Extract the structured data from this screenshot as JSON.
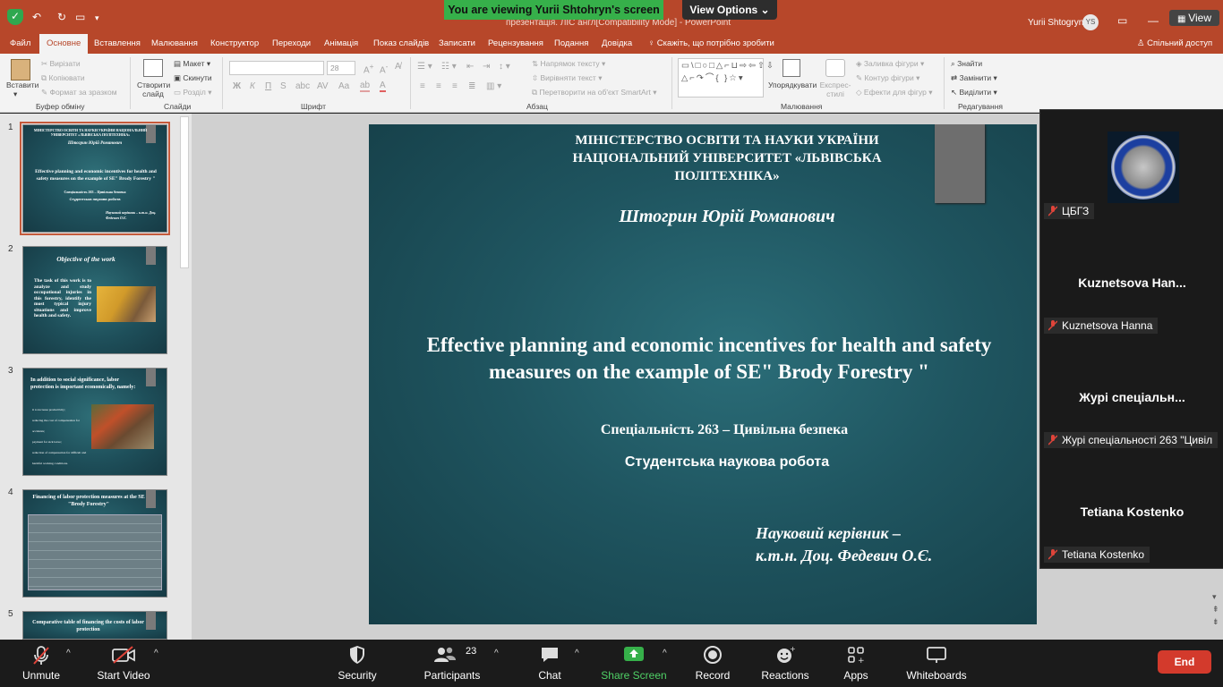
{
  "titlebar": {
    "doc_title": "презентація. ЛІС англ[Compatibility Mode] - PowerPoint",
    "user_name": "Yurii Shtogryn",
    "user_initials": "YS"
  },
  "zoom_banner": {
    "sharing_text": "You are viewing Yurii Shtohryn's screen",
    "view_options": "View Options ⌄",
    "view_button": "View"
  },
  "ribbon_tabs": [
    "Файл",
    "Основне",
    "Вставлення",
    "Малювання",
    "Конструктор",
    "Переходи",
    "Анімація",
    "Показ слайдів",
    "Записати",
    "Рецензування",
    "Подання",
    "Довідка"
  ],
  "active_tab": "Основне",
  "tell_me": "Скажіть, що потрібно зробити",
  "share_doc": "Спільний доступ",
  "ribbon": {
    "paste": "Вставити",
    "cut": "Вирізати",
    "copy": "Копіювати",
    "format_painter": "Формат за зразком",
    "new_slide": "Створити слайд",
    "layout": "Макет",
    "reset": "Скинути",
    "section": "Розділ",
    "text_direction": "Напрямок тексту",
    "align_text": "Вирівняти текст",
    "smartart": "Перетворити на об'єкт SmartArt",
    "arrange": "Упорядкувати",
    "quick_styles": "Експрес-стилі",
    "shape_fill": "Заливка фігури",
    "shape_outline": "Контур фігури",
    "shape_effects": "Ефекти для фігур",
    "find": "Знайти",
    "replace": "Замінити",
    "select": "Виділити",
    "font_size": "28",
    "groups": {
      "clipboard": "Буфер обміну",
      "slides": "Слайди",
      "font": "Шрифт",
      "paragraph": "Абзац",
      "drawing": "Малювання",
      "editing": "Редагування"
    }
  },
  "thumbnails": [
    {
      "num": "1",
      "header": "МІНІСТЕРСТВО ОСВІТИ ТА НАУКИ УКРАЇНИ НАЦІОНАЛЬНИЙ УНІВЕРСИТЕТ «ЛЬВІВСЬКА ПОЛІТЕХНІКА»",
      "name": "Штогрин Юрій Романович",
      "title": "Effective planning and economic incentives for health and safety measures on the example of SE\" Brody Forestry \"",
      "spec": "Спеціальність 263 – Цивільна безпека",
      "work": "Студентська наукова робота",
      "advisor": "Науковий керівник – к.т.н. Доц. Федевич О.Є."
    },
    {
      "num": "2",
      "title": "Objective of the work",
      "body": "The task of this work is to analyze and study occupational injuries in this forestry, identify the most typical injury situations and improve health and safety."
    },
    {
      "num": "3",
      "title": "In addition to social significance, labor protection is important economically, namely:",
      "bullets": [
        "it to increase productivity;",
        "reducing the cost of compensation for accidents;",
        "payment for sick leave;",
        "reduction of compensation for difficult and harmful working conditions."
      ]
    },
    {
      "num": "4",
      "title": "Financing of labor protection measures at the SE \"Brody Forestry\""
    },
    {
      "num": "5",
      "title": "Comparative table of financing the costs of labor protection"
    }
  ],
  "slide": {
    "header_line1": "МІНІСТЕРСТВО ОСВІТИ ТА НАУКИ УКРАЇНИ",
    "header_line2": "НАЦІОНАЛЬНИЙ УНІВЕРСИТЕТ «ЛЬВІВСЬКА",
    "header_line3": "ПОЛІТЕХНІКА»",
    "author": "Штогрин Юрій Романович",
    "title_line1": "Effective planning and economic incentives for health and safety",
    "title_line2": "measures on the example of SE\" Brody Forestry \"",
    "specialty": "Спеціальність 263 – Цивільна безпека",
    "work_type": "Студентська наукова робота",
    "advisor_line1": "Науковий керівник –",
    "advisor_line2": "к.т.н.  Доц. Федевич О.Є."
  },
  "participants": [
    {
      "label": "ЦБГЗ",
      "big": ""
    },
    {
      "label": "Kuznetsova Hanna",
      "big": "Kuznetsova  Han..."
    },
    {
      "label": "Журі спеціальності 263 \"Цивіл",
      "big": "Журі спеціальн..."
    },
    {
      "label": "Tetiana Kostenko",
      "big": "Tetiana Kostenko"
    }
  ],
  "toolbar": {
    "unmute": "Unmute",
    "start_video": "Start Video",
    "security": "Security",
    "participants": "Participants",
    "participants_count": "23",
    "chat": "Chat",
    "share_screen": "Share Screen",
    "record": "Record",
    "reactions": "Reactions",
    "apps": "Apps",
    "whiteboards": "Whiteboards",
    "end": "End"
  },
  "colors": {
    "ppt_accent": "#b7472a",
    "slide_bg": "#1f5560",
    "share_green": "#36b04a",
    "end_red": "#d33a2c"
  }
}
